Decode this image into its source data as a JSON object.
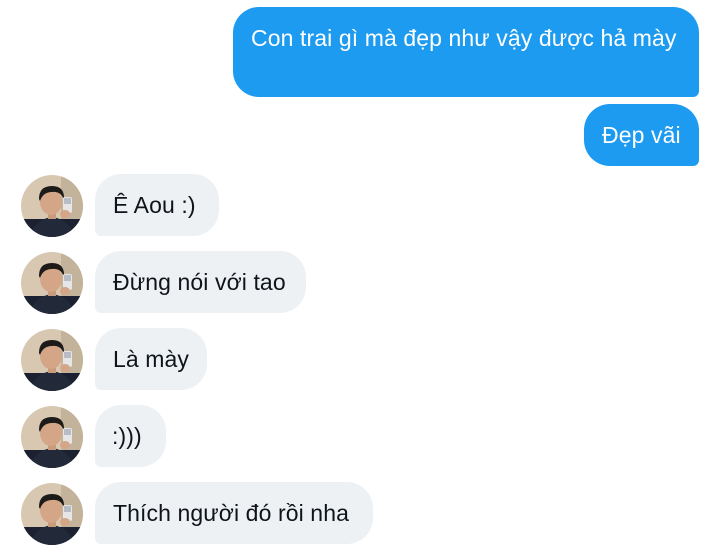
{
  "messages": {
    "sent": [
      {
        "text": "Con trai gì mà đẹp như vậy được hả mày"
      },
      {
        "text": "Đẹp vãi"
      }
    ],
    "received": [
      {
        "text": "Ê Aou :)"
      },
      {
        "text": "Đừng nói với tao"
      },
      {
        "text": "Là mày"
      },
      {
        "text": ":)))"
      },
      {
        "text": "Thích người đó rồi nha"
      }
    ]
  },
  "colors": {
    "sent_bubble": "#1d9bf0",
    "received_bubble": "#eef1f4",
    "text_dark": "#0f1419"
  }
}
